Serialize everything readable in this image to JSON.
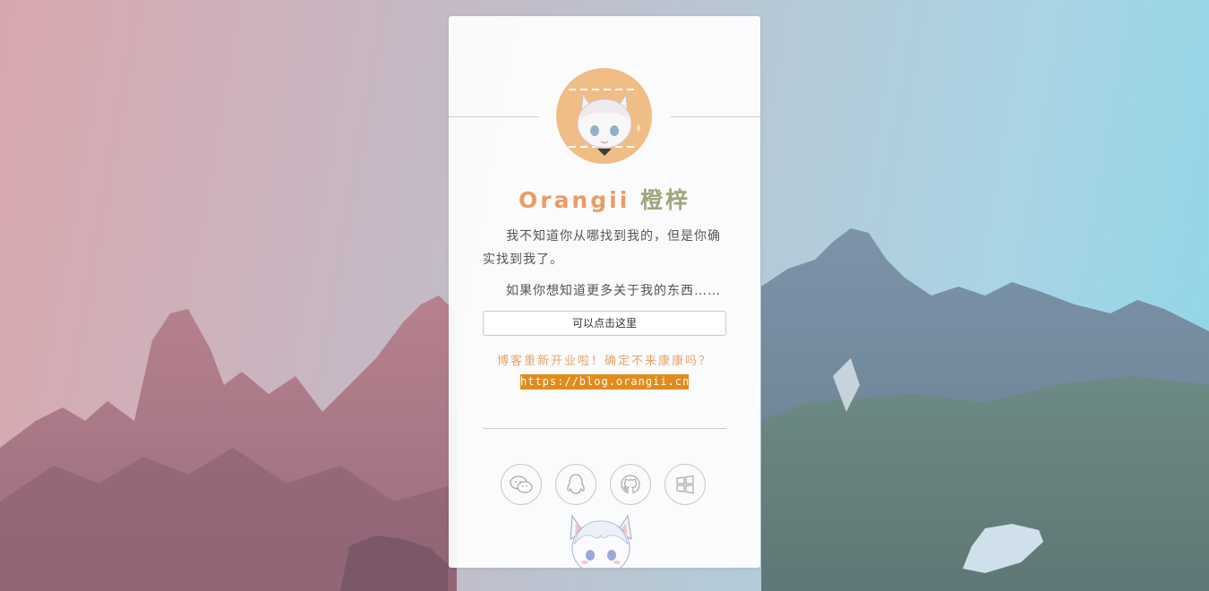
{
  "profile": {
    "name": "Orangii",
    "name_cn": "橙梓",
    "intro_line1": "我不知道你从哪找到我的，但是你确实找到我了。",
    "intro_line2": "如果你想知道更多关于我的东西……",
    "button_label": "可以点击这里",
    "promo_text": "博客重新开业啦！确定不来康康吗？",
    "blog_url": "https://blog.orangii.cn"
  },
  "social_icons": [
    "wechat-icon",
    "qq-icon",
    "github-icon",
    "windows-icon"
  ],
  "colors": {
    "name_orange": "#ec9b64",
    "name_cn": "#a0a67b",
    "url_bg": "#e18b1c",
    "avatar_bg": "#f1bd86"
  }
}
